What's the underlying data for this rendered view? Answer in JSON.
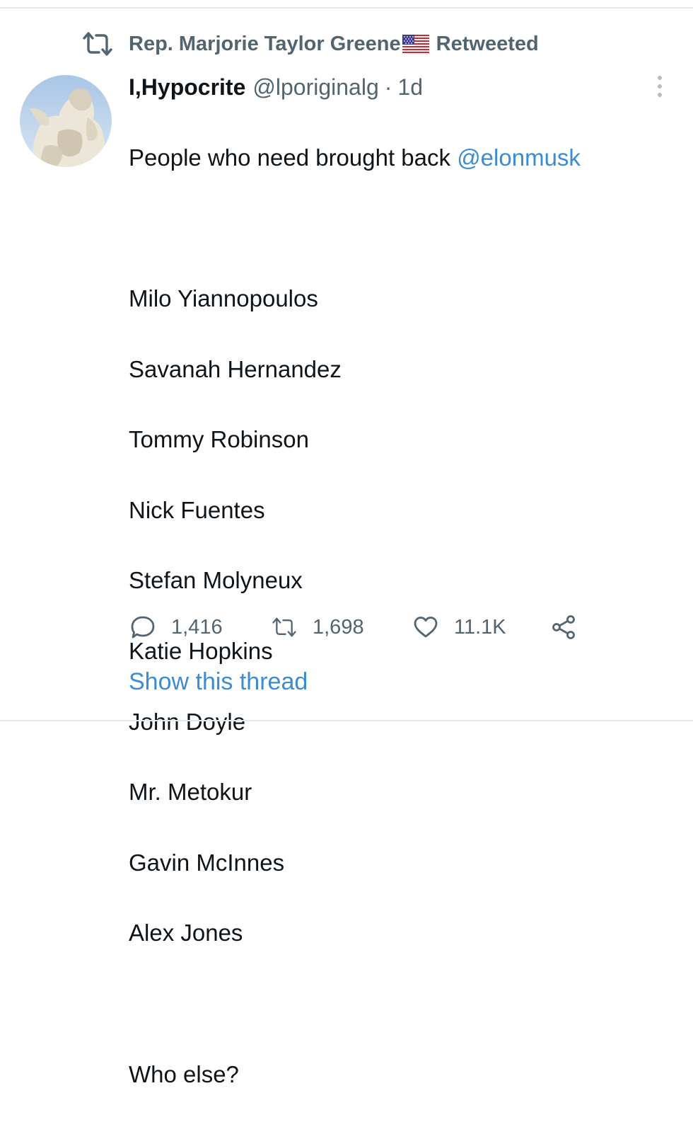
{
  "retweet_banner": {
    "name": "Rep. Marjorie Taylor Greene",
    "label": "Retweeted",
    "icon": "retweet-icon",
    "flag": "us-flag-emoji"
  },
  "tweet": {
    "display_name": "I,Hypocrite",
    "handle": "@lporiginalg",
    "separator": "·",
    "time": "1d",
    "text_prefix": "People who need brought back ",
    "mention": "@elonmusk",
    "list": [
      "Milo Yiannopoulos",
      "Savanah Hernandez",
      "Tommy Robinson",
      "Nick Fuentes",
      "Stefan Molyneux",
      "Katie Hopkins",
      "John Doyle",
      "Mr. Metokur",
      "Gavin McInnes",
      "Alex Jones"
    ],
    "closing": "Who else?"
  },
  "actions": {
    "replies": "1,416",
    "retweets": "1,698",
    "likes": "11.1K"
  },
  "show_thread": "Show this thread",
  "colors": {
    "accent": "#3b8cd0",
    "secondary_text": "#536471",
    "primary_text": "#0f1419"
  }
}
